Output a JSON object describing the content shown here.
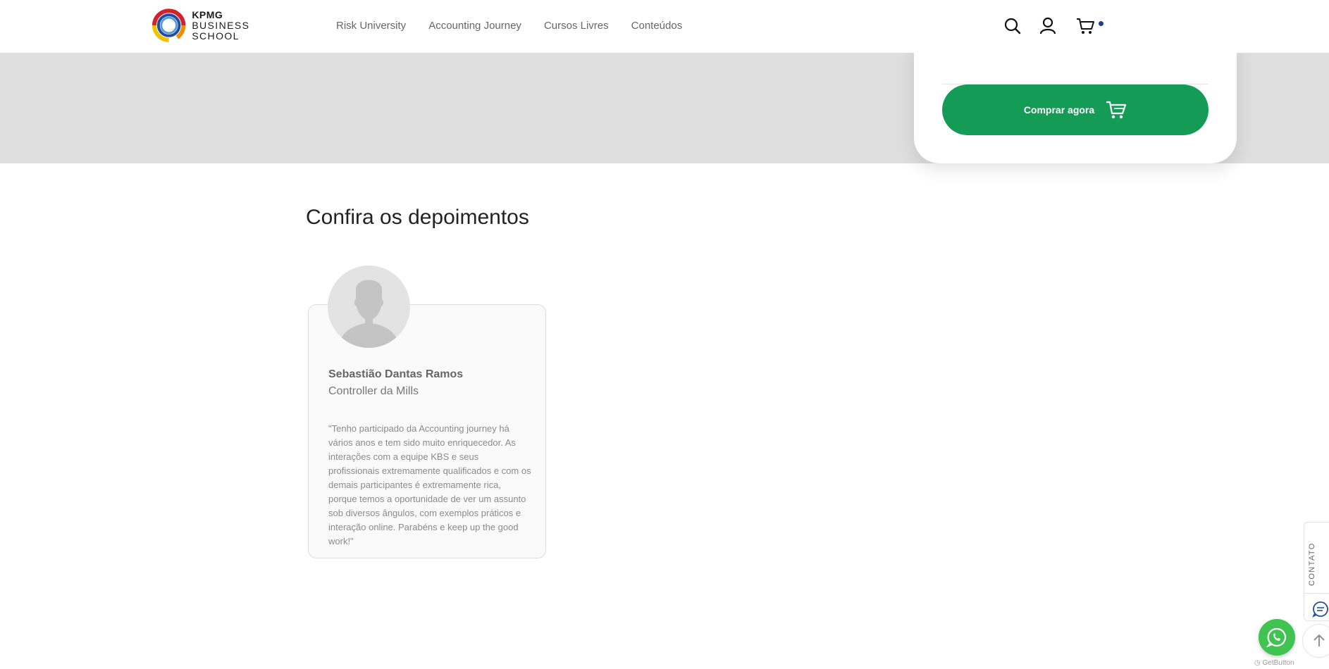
{
  "header": {
    "logo": {
      "line1": "KPMG",
      "line2": "BUSINESS SCHOOL"
    },
    "nav": [
      "Risk University",
      "Accounting Journey",
      "Cursos Livres",
      "Conteúdos"
    ],
    "icons": [
      "search-icon",
      "user-icon",
      "cart-icon"
    ]
  },
  "buy_card": {
    "button_label": "Comprar agora",
    "button_color": "#149c56"
  },
  "testimonials": {
    "title": "Confira os depoimentos",
    "items": [
      {
        "name": "Sebastião Dantas Ramos",
        "role": "Controller da Mills",
        "quote": "\"Tenho participado da Accounting journey há vários anos e tem sido muito enriquecedor. As interações com a equipe KBS e seus profissionais extremamente qualificados e com os demais participantes é extremamente rica, porque temos a oportunidade de ver um assunto sob diversos ângulos, com exemplos práticos e interação online. Parabéns e keep up the good work!\""
      }
    ]
  },
  "floating": {
    "contato_label": "CONTATO",
    "getbutton_label": "GetButton",
    "whatsapp_color": "#40c351"
  }
}
